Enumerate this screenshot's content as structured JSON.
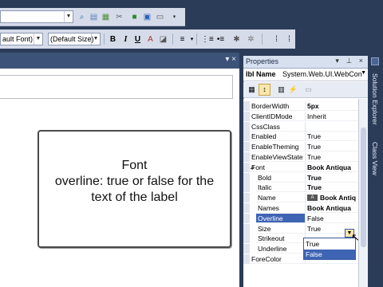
{
  "toolbar": {
    "font_name": "(Default Font)",
    "font_name_visible": "ault Font)",
    "font_size": "(Default Size)",
    "bold": "B",
    "italic": "I",
    "underline": "U"
  },
  "properties": {
    "title": "Properties",
    "title_buttons": "▾ ⊥ ×",
    "object_label": "lbl",
    "object_name": "Name",
    "object_type": "System.Web.UI.WebCon",
    "rows": [
      {
        "name": "BorderWidth",
        "value": "5px",
        "bold": true
      },
      {
        "name": "ClientIDMode",
        "value": "Inherit",
        "bold": false
      },
      {
        "name": "CssClass",
        "value": "",
        "bold": false
      },
      {
        "name": "Enabled",
        "value": "True",
        "bold": false
      },
      {
        "name": "EnableTheming",
        "value": "True",
        "bold": false
      },
      {
        "name": "EnableViewState",
        "value": "True",
        "bold": false
      },
      {
        "name": "Font",
        "value": "Book Antiqua",
        "bold": true,
        "expander": "⊿"
      },
      {
        "name": "Bold",
        "value": "True",
        "bold": true,
        "indent": true
      },
      {
        "name": "Italic",
        "value": "True",
        "bold": true,
        "indent": true
      },
      {
        "name": "Name",
        "value": "Book Antiq",
        "bold": true,
        "indent": true
      },
      {
        "name": "Names",
        "value": "Book Antiqua",
        "bold": true,
        "indent": true
      },
      {
        "name": "Overline",
        "value": "False",
        "bold": false,
        "indent": true,
        "selected": true
      },
      {
        "name": "Size",
        "value": "True",
        "bold": false,
        "indent": true
      },
      {
        "name": "Strikeout",
        "value": "",
        "bold": false,
        "indent": true
      },
      {
        "name": "Underline",
        "value": "False",
        "bold": false,
        "indent": true
      },
      {
        "name": "ForeColor",
        "value": "",
        "bold": false
      }
    ],
    "dropdown_options": [
      "True",
      "False"
    ],
    "dropdown_selected": "False"
  },
  "callout": {
    "line1": "Font",
    "line2": "overline: true or false for the",
    "line3": "text of the label"
  },
  "side_tabs": {
    "solution_explorer": "Solution Explorer",
    "class_view": "Class View"
  },
  "colors": {
    "chrome": "#2b3c59",
    "toolbar": "#d6dbe9",
    "selection": "#3e64b4",
    "highlight": "#fce6a9"
  }
}
